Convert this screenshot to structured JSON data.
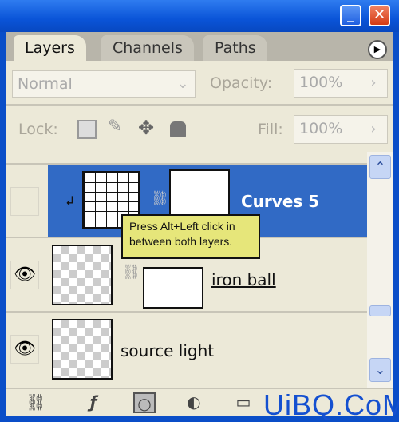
{
  "window": {
    "minimize": "_",
    "close": "✕"
  },
  "tabs": [
    {
      "label": "Layers",
      "active": true
    },
    {
      "label": "Channels",
      "active": false
    },
    {
      "label": "Paths",
      "active": false
    }
  ],
  "blend": {
    "mode": "Normal",
    "opacity_label": "Opacity:",
    "opacity": "100%"
  },
  "lock": {
    "label": "Lock:",
    "fill_label": "Fill:",
    "fill": "100%"
  },
  "layers": [
    {
      "name": "Curves 5",
      "selected": true,
      "visible": false
    },
    {
      "name": "iron ball",
      "selected": false,
      "visible": true
    },
    {
      "name": "source light",
      "selected": false,
      "visible": true
    }
  ],
  "tooltip": "Press Alt+Left click in between both layers.",
  "colors": {
    "selection": "#316ac5",
    "panel": "#ece9d8",
    "tooltip": "#e6e67a"
  },
  "watermark": "UiBQ.CoM"
}
